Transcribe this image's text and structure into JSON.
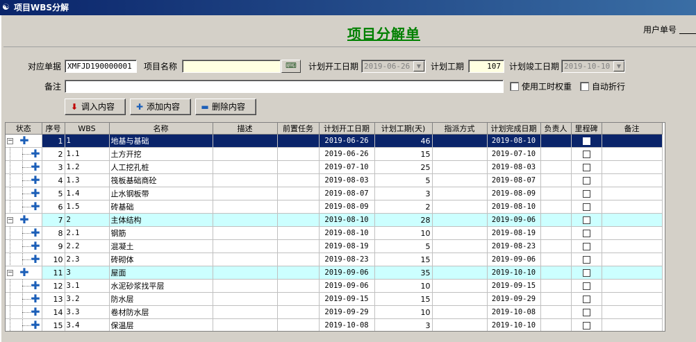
{
  "window": {
    "title": "项目WBS分解"
  },
  "form": {
    "title": "项目分解单",
    "user_no_label": "用户单号",
    "doc_label": "对应单据",
    "doc_value": "XMFJD190000001",
    "project_name_label": "项目名称",
    "project_name_value": "",
    "plan_start_label": "计划开工日期",
    "plan_start_value": "2019-06-26",
    "duration_label": "计划工期",
    "duration_value": "107",
    "plan_end_label": "计划竣工日期",
    "plan_end_value": "2019-10-10",
    "remark_label": "备注",
    "remark_value": "",
    "use_hours_weight_label": "使用工时权重",
    "auto_collapse_label": "自动折行"
  },
  "buttons": {
    "import": "调入内容",
    "add": "添加内容",
    "delete": "删除内容"
  },
  "columns": [
    "状态",
    "序号",
    "WBS",
    "名称",
    "描述",
    "前置任务",
    "计划开工日期",
    "计划工期(天)",
    "指派方式",
    "计划完成日期",
    "负责人",
    "里程碑",
    "备注"
  ],
  "rows": [
    {
      "seq": "1",
      "wbs": "1",
      "name": "地基与基础",
      "start": "2019-06-26",
      "days": "46",
      "end": "2019-08-10",
      "level": 0,
      "selected": true
    },
    {
      "seq": "2",
      "wbs": "1.1",
      "name": "土方开挖",
      "start": "2019-06-26",
      "days": "15",
      "end": "2019-07-10",
      "level": 1
    },
    {
      "seq": "3",
      "wbs": "1.2",
      "name": "人工挖孔桩",
      "start": "2019-07-10",
      "days": "25",
      "end": "2019-08-03",
      "level": 1
    },
    {
      "seq": "4",
      "wbs": "1.3",
      "name": "筏板基础商砼",
      "start": "2019-08-03",
      "days": "5",
      "end": "2019-08-07",
      "level": 1
    },
    {
      "seq": "5",
      "wbs": "1.4",
      "name": "止水钢板带",
      "start": "2019-08-07",
      "days": "3",
      "end": "2019-08-09",
      "level": 1
    },
    {
      "seq": "6",
      "wbs": "1.5",
      "name": "砖基础",
      "start": "2019-08-09",
      "days": "2",
      "end": "2019-08-10",
      "level": 1
    },
    {
      "seq": "7",
      "wbs": "2",
      "name": "主体结构",
      "start": "2019-08-10",
      "days": "28",
      "end": "2019-09-06",
      "level": 0
    },
    {
      "seq": "8",
      "wbs": "2.1",
      "name": "钢筋",
      "start": "2019-08-10",
      "days": "10",
      "end": "2019-08-19",
      "level": 1
    },
    {
      "seq": "9",
      "wbs": "2.2",
      "name": "混凝土",
      "start": "2019-08-19",
      "days": "5",
      "end": "2019-08-23",
      "level": 1
    },
    {
      "seq": "10",
      "wbs": "2.3",
      "name": "砖砌体",
      "start": "2019-08-23",
      "days": "15",
      "end": "2019-09-06",
      "level": 1
    },
    {
      "seq": "11",
      "wbs": "3",
      "name": "屋面",
      "start": "2019-09-06",
      "days": "35",
      "end": "2019-10-10",
      "level": 0
    },
    {
      "seq": "12",
      "wbs": "3.1",
      "name": "水泥砂浆找平层",
      "start": "2019-09-06",
      "days": "10",
      "end": "2019-09-15",
      "level": 1
    },
    {
      "seq": "13",
      "wbs": "3.2",
      "name": "防水层",
      "start": "2019-09-15",
      "days": "15",
      "end": "2019-09-29",
      "level": 1
    },
    {
      "seq": "14",
      "wbs": "3.3",
      "name": "卷材防水层",
      "start": "2019-09-29",
      "days": "10",
      "end": "2019-10-08",
      "level": 1
    },
    {
      "seq": "15",
      "wbs": "3.4",
      "name": "保温层",
      "start": "2019-10-08",
      "days": "3",
      "end": "2019-10-10",
      "level": 1
    }
  ],
  "colors": {
    "title_green": "#008000",
    "selection": "#0a246a",
    "parent_row": "#ccffff",
    "plus_blue": "#1c5fb8"
  }
}
